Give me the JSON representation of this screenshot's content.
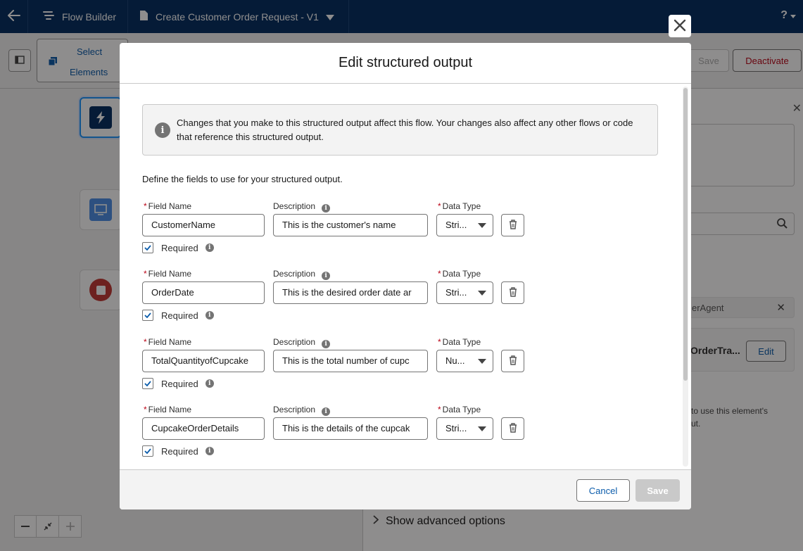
{
  "topbar": {
    "app_name": "Flow Builder",
    "flow_name": "Create Customer Order Request - V1",
    "help": "?"
  },
  "toolbar": {
    "select_elements_line1": "Select",
    "select_elements_line2": "Elements",
    "save_label": "Save",
    "deactivate_label": "Deactivate"
  },
  "panel": {
    "agent_pill": "erAgent",
    "card_title": "OrderTra...",
    "edit_label": "Edit",
    "help_line1": "to use this element's",
    "help_line2": "ut.",
    "advanced_label": "Show advanced options"
  },
  "modal": {
    "title": "Edit structured output",
    "notice": "Changes that you make to this structured output affect this flow. Your changes also affect any other flows or code that reference this structured output.",
    "intro": "Define the fields to use for your structured output.",
    "field_name_label": "Field Name",
    "description_label": "Description",
    "data_type_label": "Data Type",
    "required_label": "Required",
    "fields": [
      {
        "name": "CustomerName",
        "description": "This is the customer's name",
        "data_type": "Stri...",
        "required": true
      },
      {
        "name": "OrderDate",
        "description": "This is the desired order date ar",
        "data_type": "Stri...",
        "required": true
      },
      {
        "name": "TotalQuantityofCupcake",
        "description": "This is the total number of cupc",
        "data_type": "Nu...",
        "required": true
      },
      {
        "name": "CupcakeOrderDetails",
        "description": "This is the details of the cupcak",
        "data_type": "Stri...",
        "required": true
      }
    ],
    "cancel_label": "Cancel",
    "save_label": "Save"
  },
  "colors": {
    "header_bg": "#032d60",
    "brand_blue": "#0b5cab",
    "destructive_red": "#ba0517",
    "node_trigger": "#032d60",
    "node_screen": "#4d8fe8",
    "node_stop": "#c23934"
  }
}
